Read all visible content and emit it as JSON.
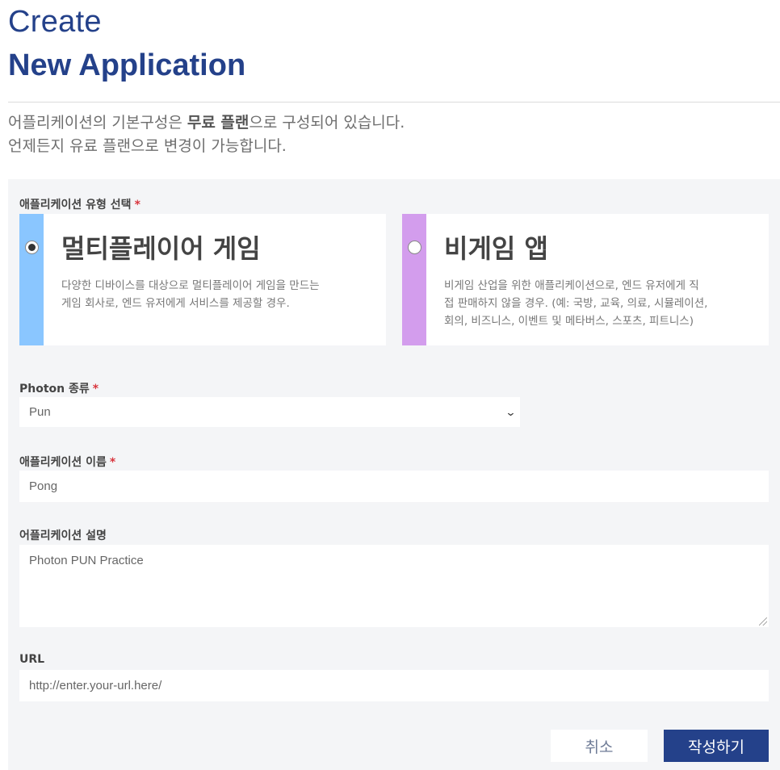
{
  "header": {
    "title_line1": "Create",
    "title_line2": "New Application"
  },
  "intro": {
    "line1_pre": "어플리케이션의 기본구성은 ",
    "line1_bold": "무료 플랜",
    "line1_post": "으로 구성되어 있습니다.",
    "line2": "언제든지 유료 플랜으로 변경이 가능합니다."
  },
  "type_select": {
    "label": "애플리케이션 유형 선택",
    "required_mark": "*",
    "options": [
      {
        "title": "멀티플레이어 게임",
        "desc_lines": [
          "다양한 디바이스를 대상으로 멀티플레이어 게임을 만드는",
          "게임 회사로, 엔드 유저에게 서비스를 제공할 경우."
        ],
        "selected": true,
        "color": "#8ac6ff"
      },
      {
        "title": "비게임 앱",
        "desc_lines": [
          "비게임 산업을 위한 애플리케이션으로, 엔드 유저에게 직",
          "접 판매하지 않을 경우. (예: 국방, 교육, 의료, 시뮬레이션,",
          "회의, 비즈니스, 이벤트 및 메타버스, 스포츠, 피트니스)"
        ],
        "selected": false,
        "color": "#d39ded"
      }
    ]
  },
  "photon_type": {
    "label": "Photon 종류",
    "required_mark": "*",
    "value": "Pun",
    "icon": "chevron-down-icon"
  },
  "app_name": {
    "label": "애플리케이션 이름",
    "required_mark": "*",
    "value": "Pong"
  },
  "app_desc": {
    "label": "어플리케이션 설명",
    "value": "Photon PUN Practice"
  },
  "url": {
    "label": "URL",
    "value": "http://enter.your-url.here/"
  },
  "buttons": {
    "cancel": "취소",
    "submit": "작성하기"
  },
  "colors": {
    "brand": "#24418a",
    "required": "#d9363e",
    "panel_bg": "#f4f5f7"
  }
}
